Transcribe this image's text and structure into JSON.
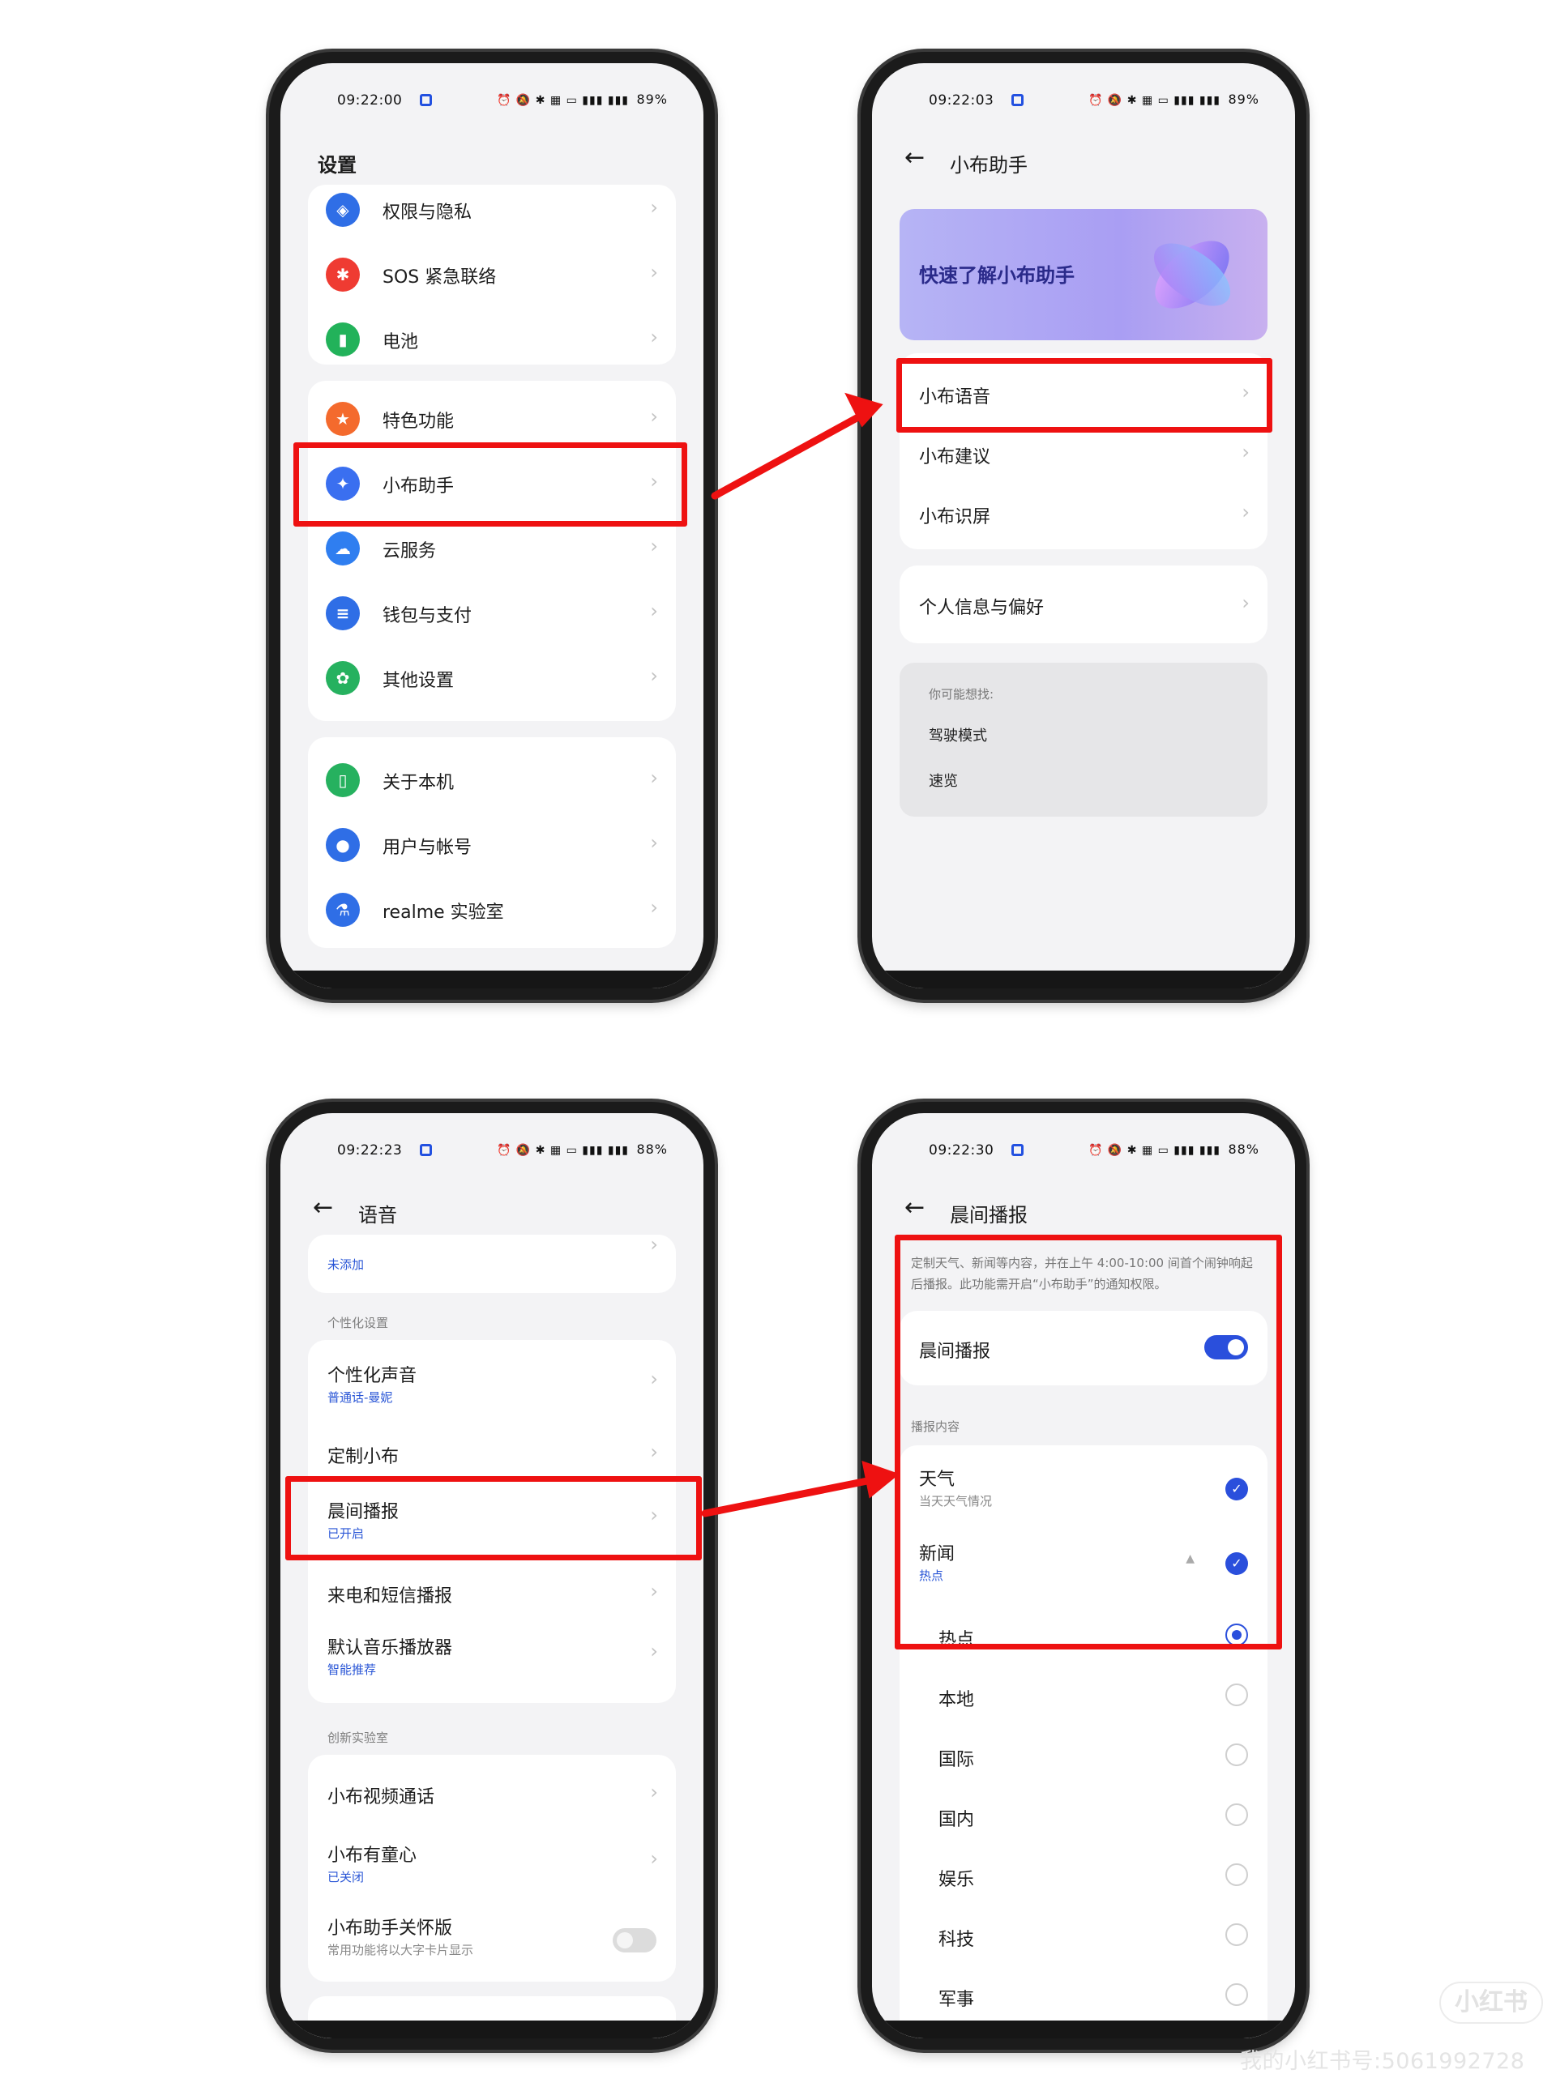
{
  "status": {
    "time_1": "09:22:00",
    "battery_1": "89%",
    "time_2": "09:22:03",
    "battery_2": "89%",
    "time_3": "09:22:23",
    "battery_3": "88%",
    "time_4": "09:22:30",
    "battery_4": "88%",
    "icons": "⏰ 🔕 ✱ ▦ ▭ ▮▮▮ ▮▮▮"
  },
  "screen1": {
    "title": "设置",
    "items": [
      {
        "label": "权限与隐私",
        "icon": "shield-icon",
        "color": "#2f6ee6"
      },
      {
        "label": "SOS 紧急联络",
        "icon": "sos-icon",
        "color": "#ef3b32"
      },
      {
        "label": "电池",
        "icon": "battery-icon",
        "color": "#22b25a"
      },
      {
        "label": "特色功能",
        "icon": "star-icon",
        "color": "#f46a2d"
      },
      {
        "label": "小布助手",
        "icon": "assistant-icon",
        "color": "#3a6ff0"
      },
      {
        "label": "云服务",
        "icon": "cloud-icon",
        "color": "#2f7ef0"
      },
      {
        "label": "钱包与支付",
        "icon": "wallet-icon",
        "color": "#2f6ee6"
      },
      {
        "label": "其他设置",
        "icon": "gear-icon",
        "color": "#26b15f"
      },
      {
        "label": "关于本机",
        "icon": "phone-icon",
        "color": "#26b15f"
      },
      {
        "label": "用户与帐号",
        "icon": "user-icon",
        "color": "#2f6ee6"
      },
      {
        "label": "realme 实验室",
        "icon": "flask-icon",
        "color": "#2f6ee6"
      }
    ]
  },
  "screen2": {
    "title": "小布助手",
    "promo": "快速了解小布助手",
    "items": [
      {
        "label": "小布语音"
      },
      {
        "label": "小布建议"
      },
      {
        "label": "小布识屏"
      },
      {
        "label": "个人信息与偏好"
      }
    ],
    "suggest_title": "你可能想找:",
    "suggest_items": [
      "驾驶模式",
      "速览"
    ]
  },
  "screen3": {
    "title": "语音",
    "top_sub": "未添加",
    "section1": "个性化设置",
    "items": [
      {
        "label": "个性化声音",
        "sub": "普通话-曼妮"
      },
      {
        "label": "定制小布"
      },
      {
        "label": "晨间播报",
        "sub": "已开启"
      },
      {
        "label": "来电和短信播报"
      },
      {
        "label": "默认音乐播放器",
        "sub": "智能推荐"
      }
    ],
    "section2": "创新实验室",
    "lab_items": [
      {
        "label": "小布视频通话"
      },
      {
        "label": "小布有童心",
        "sub": "已关闭"
      },
      {
        "label": "小布助手关怀版",
        "sub": "常用功能将以大字卡片显示"
      }
    ]
  },
  "screen4": {
    "title": "晨间播报",
    "description": "定制天气、新闻等内容，并在上午 4:00-10:00 间首个闹钟响起后播报。此功能需开启“小布助手”的通知权限。",
    "toggle_label": "晨间播报",
    "section": "播报内容",
    "weather": {
      "label": "天气",
      "sub": "当天天气情况"
    },
    "news": {
      "label": "新闻",
      "sub": "热点"
    },
    "news_options": [
      "热点",
      "本地",
      "国际",
      "国内",
      "娱乐",
      "科技",
      "军事"
    ]
  },
  "watermark": {
    "logo": "小红书",
    "id": "我的小红书号:5061992728"
  },
  "colors": {
    "highlight": "#ee1111",
    "accent": "#2a4fdc"
  }
}
